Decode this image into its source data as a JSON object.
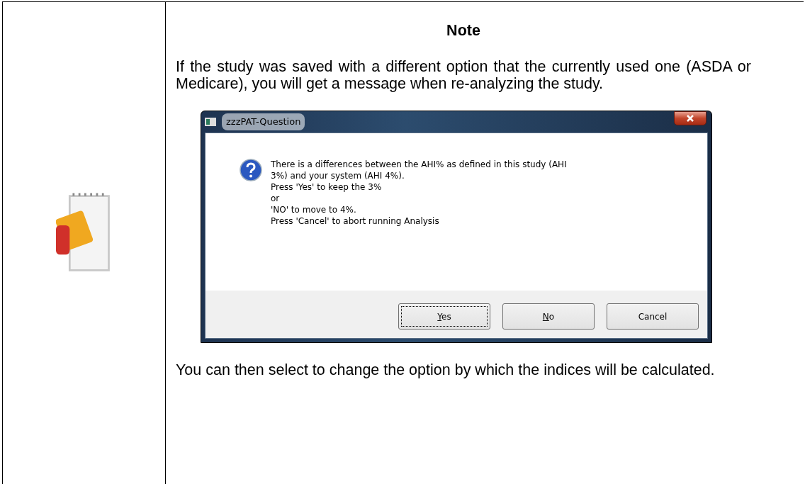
{
  "note": {
    "title": "Note",
    "intro": "If the study was saved with a different option that the currently used one (ASDA or Medicare), you will get a message when re-analyzing the study.",
    "dialog": {
      "title": "zzzPAT-Question",
      "message_lines": [
        "There is a differences between the AHI% as defined in this study (AHI 3%) and your system (AHI 4%).",
        "Press 'Yes' to keep the 3%",
        "or",
        "'NO' to move to 4%.",
        "Press 'Cancel' to abort running Analysis"
      ],
      "buttons": [
        {
          "label": "Yes",
          "access_key": true,
          "focused": true
        },
        {
          "label": "No",
          "access_key": true,
          "focused": false
        },
        {
          "label": "Cancel",
          "access_key": false,
          "focused": false
        }
      ]
    },
    "outro": "You can then select to change the option by which the indices will be calculated."
  }
}
